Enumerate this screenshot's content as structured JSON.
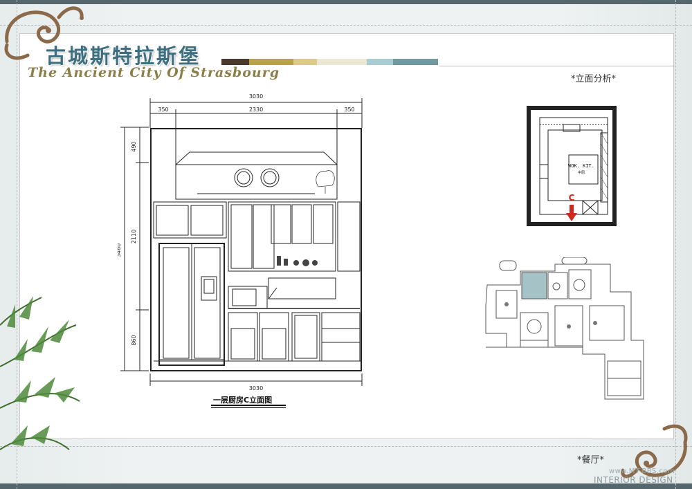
{
  "header": {
    "title_cn": "古城斯特拉斯堡",
    "title_en": "The Ancient City Of Strasbourg",
    "swatches": [
      "#4a3a2e",
      "#b9a04a",
      "#dcc98b",
      "#ece7d4",
      "#a9ccd2",
      "#6e9aa0"
    ]
  },
  "section_label": "*立面分析*",
  "elevation": {
    "dim_top_total": "3030",
    "dim_top_left": "350",
    "dim_top_mid": "2330",
    "dim_top_right": "350",
    "dim_bottom_total": "3030",
    "dim_left_total": "3460",
    "dim_left_top": "490",
    "dim_left_mid": "2110",
    "dim_left_bottom": "860",
    "caption": "一层厨房C立面图"
  },
  "key_plan": {
    "room_label": "WOK. KIT.",
    "room_sub": "中厨",
    "marker": "C"
  },
  "footer": {
    "label": "*餐厅*",
    "watermark_site": "www.MT-BBS.com",
    "watermark_text": "INTERIOR DESIGN"
  },
  "colors": {
    "band": "#55676c",
    "title": "#3d6f80",
    "marker": "#cc2a1f",
    "plan_highlight": "#8fb3b8"
  }
}
